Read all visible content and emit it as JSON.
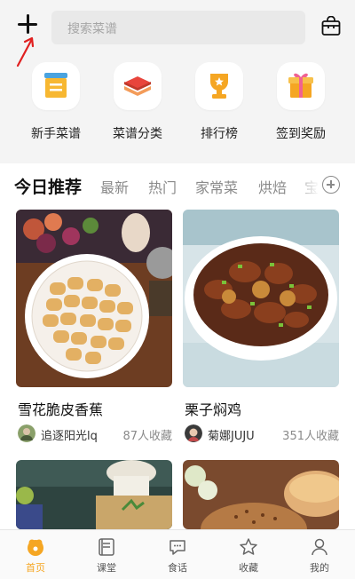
{
  "search": {
    "placeholder": "搜索菜谱"
  },
  "quick_links": [
    {
      "label": "新手菜谱",
      "icon": "beginner-recipe-icon"
    },
    {
      "label": "菜谱分类",
      "icon": "category-layers-icon"
    },
    {
      "label": "排行榜",
      "icon": "trophy-icon"
    },
    {
      "label": "签到奖励",
      "icon": "gift-icon"
    }
  ],
  "tabs": [
    "今日推荐",
    "最新",
    "热门",
    "家常菜",
    "烘焙",
    "宝"
  ],
  "recipes": [
    {
      "title": "雪花脆皮香蕉",
      "author": "追逐阳光lq",
      "favorites": "87人收藏"
    },
    {
      "title": "栗子焖鸡",
      "author": "菊娜JUJU",
      "favorites": "351人收藏"
    }
  ],
  "bottom_nav": [
    {
      "label": "首页",
      "icon": "home-icon",
      "active": true
    },
    {
      "label": "课堂",
      "icon": "classroom-icon",
      "active": false
    },
    {
      "label": "食话",
      "icon": "chat-icon",
      "active": false
    },
    {
      "label": "收藏",
      "icon": "star-icon",
      "active": false
    },
    {
      "label": "我的",
      "icon": "user-icon",
      "active": false
    }
  ],
  "colors": {
    "accent": "#f5a623",
    "background": "#f4f4f4",
    "arrow": "#e02020"
  }
}
